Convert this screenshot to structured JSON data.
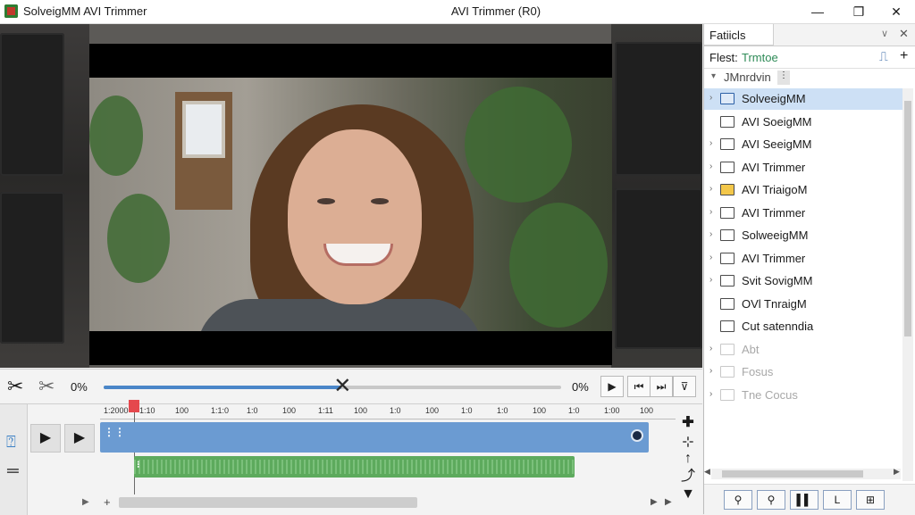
{
  "window": {
    "app_title": "SolveigMM AVI Trimmer",
    "center_title": "AVI Trimmer (R0)",
    "minimize": "—",
    "maximize": "❐",
    "close": "✕"
  },
  "controls": {
    "cut_icon": "✂",
    "cut2_icon": "✂",
    "left_pct": "0%",
    "right_pct": "0%",
    "seek_progress": 0.52,
    "buttons": [
      "▶",
      "⏮",
      "⏭",
      "⊽"
    ]
  },
  "timeline": {
    "ruler_ticks": [
      "1:2000",
      "1:10",
      "100",
      "1:1:0",
      "1:0",
      "100",
      "1:11",
      "100",
      "1:0",
      "100",
      "1:0",
      "1:0",
      "100",
      "1:0",
      "1:00",
      "100"
    ],
    "video_label": "⋮⋮",
    "audio_label": "⁝"
  },
  "panel": {
    "tab": "Fatiicls",
    "filter_label": "Flest:",
    "filter_value": "Trmtoe",
    "folder_path": "JMnrdvin",
    "items": [
      {
        "label": "SolveeigMM",
        "selected": true
      },
      {
        "label": "AVI SoeigMM",
        "selected": false
      },
      {
        "label": "AVI SeeigMM",
        "selected": false
      },
      {
        "label": "AVI Trimmer",
        "selected": false
      },
      {
        "label": "AVI TriaigoM",
        "selected": false
      },
      {
        "label": "AVI Trimmer",
        "selected": false
      },
      {
        "label": "SolweeigMM",
        "selected": false
      },
      {
        "label": "AVI Trimmer",
        "selected": false
      },
      {
        "label": "Svit SovigMM",
        "selected": false
      },
      {
        "label": "OVl TnraigM",
        "selected": false
      },
      {
        "label": "Cut satenndia",
        "selected": false
      },
      {
        "label": "Abt",
        "selected": false
      },
      {
        "label": "Fosus",
        "selected": false
      },
      {
        "label": "Tne Cocus",
        "selected": false
      }
    ],
    "bottom_buttons": [
      "⚲",
      "⚲",
      "▌▌",
      "L",
      "⊞"
    ]
  }
}
